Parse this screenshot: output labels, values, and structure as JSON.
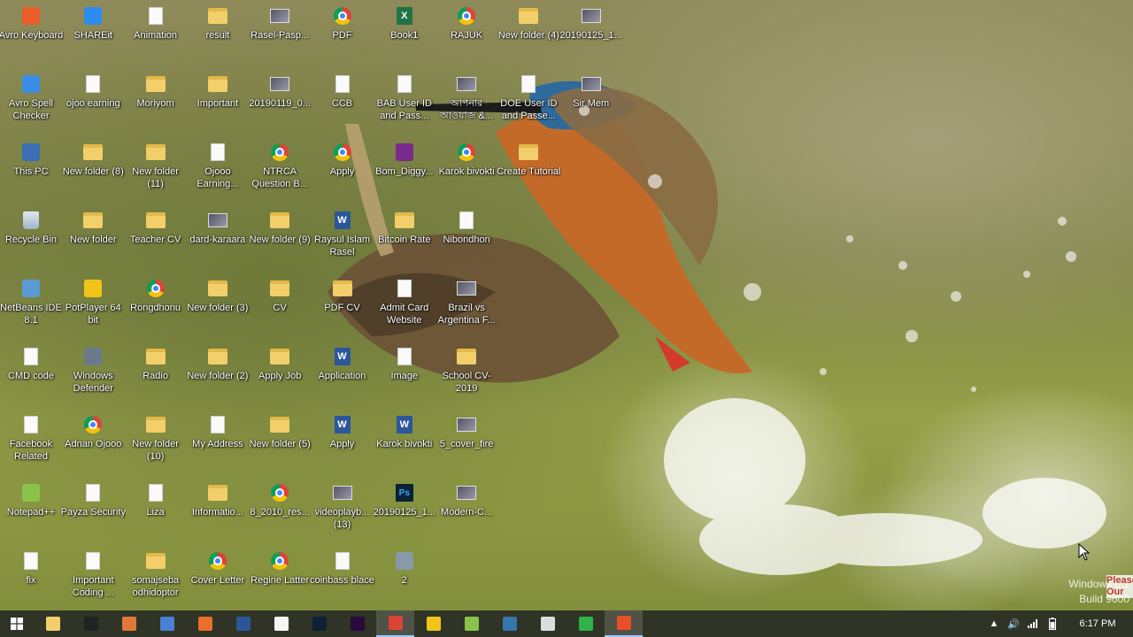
{
  "desktop": {
    "icons": [
      {
        "label": "Avro Keyboard",
        "icon": "avro-keyboard-icon",
        "type": "app",
        "color": "#e85d2a"
      },
      {
        "label": "SHAREit",
        "icon": "shareit-icon",
        "type": "app",
        "color": "#2d8cf0"
      },
      {
        "label": "Animation",
        "icon": "file-icon",
        "type": "file"
      },
      {
        "label": "result",
        "icon": "folder-icon",
        "type": "folder"
      },
      {
        "label": "Rasel-Pasp...",
        "icon": "image-icon",
        "type": "image"
      },
      {
        "label": "PDF",
        "icon": "chrome-icon",
        "type": "chrome"
      },
      {
        "label": "Book1",
        "icon": "excel-icon",
        "type": "excel"
      },
      {
        "label": "RAJUK",
        "icon": "chrome-icon",
        "type": "chrome"
      },
      {
        "label": "New folder (4)",
        "icon": "folder-icon",
        "type": "folder"
      },
      {
        "label": "20190125_1...",
        "icon": "image-icon",
        "type": "image"
      },
      {
        "label": "Avro Spell Checker",
        "icon": "spell-checker-icon",
        "type": "app",
        "color": "#3a8ee6"
      },
      {
        "label": "ojoo earning",
        "icon": "file-icon",
        "type": "file"
      },
      {
        "label": "Moriyom",
        "icon": "folder-icon",
        "type": "folder"
      },
      {
        "label": "Important",
        "icon": "folder-icon",
        "type": "folder"
      },
      {
        "label": "20190119_0...",
        "icon": "video-icon",
        "type": "image"
      },
      {
        "label": "CCB",
        "icon": "file-icon",
        "type": "file"
      },
      {
        "label": "BAB User ID and Pass...",
        "icon": "file-icon",
        "type": "file"
      },
      {
        "label": "আপনার আওয়াজ &...",
        "icon": "image-icon",
        "type": "image"
      },
      {
        "label": "DOE User ID and Passe...",
        "icon": "file-icon",
        "type": "file"
      },
      {
        "label": "Sir Mem",
        "icon": "image-icon",
        "type": "image"
      },
      {
        "label": "This PC",
        "icon": "this-pc-icon",
        "type": "app",
        "color": "#3b6fb6"
      },
      {
        "label": "New folder (8)",
        "icon": "folder-icon",
        "type": "folder"
      },
      {
        "label": "New folder (11)",
        "icon": "folder-icon",
        "type": "folder"
      },
      {
        "label": "Ojooo Earning...",
        "icon": "file-icon",
        "type": "file"
      },
      {
        "label": "NTRCA Question B...",
        "icon": "chrome-icon",
        "type": "chrome"
      },
      {
        "label": "Apply",
        "icon": "chrome-icon",
        "type": "chrome"
      },
      {
        "label": "Bom_Diggy...",
        "icon": "video-icon",
        "type": "app",
        "color": "#7a2a8a"
      },
      {
        "label": "Karok bivokti",
        "icon": "chrome-icon",
        "type": "chrome"
      },
      {
        "label": "Create Tutorial",
        "icon": "folder-icon",
        "type": "folder"
      },
      {
        "label": "Recycle Bin",
        "icon": "recycle-bin-icon",
        "type": "recycle"
      },
      {
        "label": "New folder",
        "icon": "folder-icon",
        "type": "folder"
      },
      {
        "label": "Teacher CV",
        "icon": "folder-icon",
        "type": "folder"
      },
      {
        "label": "dard-karaara",
        "icon": "video-icon",
        "type": "image"
      },
      {
        "label": "New folder (9)",
        "icon": "folder-icon",
        "type": "folder"
      },
      {
        "label": "Raysul Islam Rasel",
        "icon": "word-icon",
        "type": "word"
      },
      {
        "label": "Bitcoin Rate",
        "icon": "folder-icon",
        "type": "folder"
      },
      {
        "label": "Nibondhon",
        "icon": "file-icon",
        "type": "file"
      },
      {
        "label": "NetBeans IDE 8.1",
        "icon": "netbeans-icon",
        "type": "app",
        "color": "#5b9bd5"
      },
      {
        "label": "PotPlayer 64 bit",
        "icon": "potplayer-icon",
        "type": "app",
        "color": "#f0c419"
      },
      {
        "label": "Rongdhonu",
        "icon": "chrome-icon",
        "type": "chrome"
      },
      {
        "label": "New folder (3)",
        "icon": "folder-icon",
        "type": "folder"
      },
      {
        "label": "CV",
        "icon": "folder-icon",
        "type": "folder"
      },
      {
        "label": "PDF CV",
        "icon": "folder-icon",
        "type": "folder"
      },
      {
        "label": "Admit Card Website",
        "icon": "file-icon",
        "type": "file"
      },
      {
        "label": "Brazil vs Argentina F...",
        "icon": "video-icon",
        "type": "image"
      },
      {
        "label": "CMD code",
        "icon": "file-icon",
        "type": "file"
      },
      {
        "label": "Windows Defender",
        "icon": "windows-defender-icon",
        "type": "app",
        "color": "#6a7a8a"
      },
      {
        "label": "Radio",
        "icon": "folder-icon",
        "type": "folder"
      },
      {
        "label": "New folder (2)",
        "icon": "folder-icon",
        "type": "folder"
      },
      {
        "label": "Apply Job",
        "icon": "folder-icon",
        "type": "folder"
      },
      {
        "label": "Application",
        "icon": "word-icon",
        "type": "word"
      },
      {
        "label": "Image",
        "icon": "image-icon",
        "type": "file"
      },
      {
        "label": "School CV-2019",
        "icon": "folder-icon",
        "type": "folder"
      },
      {
        "label": "Facebook Related",
        "icon": "file-icon",
        "type": "file"
      },
      {
        "label": "Adnan Ojooo",
        "icon": "chrome-icon",
        "type": "chrome"
      },
      {
        "label": "New folder (10)",
        "icon": "folder-icon",
        "type": "folder"
      },
      {
        "label": "My Address",
        "icon": "file-icon",
        "type": "file"
      },
      {
        "label": "New folder (5)",
        "icon": "folder-icon",
        "type": "folder"
      },
      {
        "label": "Apply",
        "icon": "word-icon",
        "type": "word"
      },
      {
        "label": "Karok bivokti",
        "icon": "word-icon",
        "type": "word"
      },
      {
        "label": "5_cover_fire",
        "icon": "image-icon",
        "type": "image"
      },
      {
        "label": "Notepad++",
        "icon": "notepad-plus-plus-icon",
        "type": "app",
        "color": "#8bc34a"
      },
      {
        "label": "Payza Security",
        "icon": "file-icon",
        "type": "file"
      },
      {
        "label": "Liza",
        "icon": "file-icon",
        "type": "file"
      },
      {
        "label": "Informatio...",
        "icon": "folder-icon",
        "type": "folder"
      },
      {
        "label": "8_2010_res...",
        "icon": "chrome-icon",
        "type": "chrome"
      },
      {
        "label": "videoplayb... (13)",
        "icon": "video-icon",
        "type": "image"
      },
      {
        "label": "20190125_1...",
        "icon": "photoshop-icon",
        "type": "ps"
      },
      {
        "label": "Modern-C...",
        "icon": "video-icon",
        "type": "image"
      },
      {
        "label": "fix",
        "icon": "file-icon",
        "type": "file"
      },
      {
        "label": "Important Coding ...",
        "icon": "file-icon",
        "type": "file"
      },
      {
        "label": "somajseba odhidoptor",
        "icon": "folder-icon",
        "type": "folder"
      },
      {
        "label": "Cover Letter",
        "icon": "chrome-icon",
        "type": "chrome"
      },
      {
        "label": "Regine Latter",
        "icon": "chrome-icon",
        "type": "chrome"
      },
      {
        "label": "coinbass blace",
        "icon": "file-icon",
        "type": "file"
      },
      {
        "label": "2",
        "icon": "app-icon",
        "type": "app",
        "color": "#8899aa"
      }
    ]
  },
  "taskbar": {
    "items": [
      {
        "name": "file-explorer-icon",
        "color": "#f2cf6a"
      },
      {
        "name": "camera-app-icon",
        "color": "#222222"
      },
      {
        "name": "paint-icon",
        "color": "#e07a3a"
      },
      {
        "name": "chrome-alt-icon",
        "color": "#4a7fd4"
      },
      {
        "name": "firefox-icon",
        "color": "#e8702a"
      },
      {
        "name": "word-taskbar-icon",
        "color": "#2b579a"
      },
      {
        "name": "notepad-icon",
        "color": "#f5f5f5"
      },
      {
        "name": "photoshop-taskbar-icon",
        "color": "#0b2135"
      },
      {
        "name": "premiere-icon",
        "color": "#2a0a3a"
      },
      {
        "name": "chrome-taskbar-icon",
        "color": "#db4437",
        "active": true
      },
      {
        "name": "potplayer-taskbar-icon",
        "color": "#f0c419"
      },
      {
        "name": "android-icon",
        "color": "#8bc34a"
      },
      {
        "name": "python-icon",
        "color": "#3776ab"
      },
      {
        "name": "tool-icon",
        "color": "#dddddd"
      },
      {
        "name": "camtasia-icon",
        "color": "#2fb34a"
      },
      {
        "name": "recorder-icon",
        "color": "#e8502a",
        "active": true
      }
    ],
    "tray": {
      "icons": [
        "chevron-up-icon",
        "volume-icon",
        "network-icon",
        "battery-icon"
      ],
      "time": "6:17 PM"
    }
  },
  "watermark": {
    "line1": "Windows 8.1",
    "line2": "Build 9600"
  },
  "side_overlay": {
    "line1": "Please",
    "line2": "Our"
  }
}
